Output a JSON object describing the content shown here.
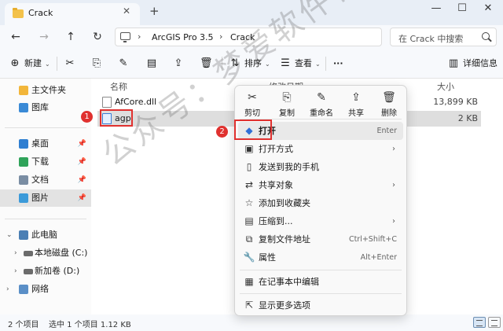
{
  "tab": {
    "title": "Crack",
    "close_glyph": "✕",
    "add_glyph": "+"
  },
  "window_controls": {
    "minimize": "—",
    "maximize": "☐",
    "close": "✕"
  },
  "nav_buttons": {
    "back": "←",
    "forward": "→",
    "up": "↑",
    "refresh": "↻"
  },
  "address": {
    "segments": [
      "ArcGIS Pro 3.5",
      "Crack"
    ],
    "separator": "›"
  },
  "search": {
    "placeholder": "在 Crack 中搜索"
  },
  "toolbar": {
    "new_label": "新建",
    "sort_label": "排序",
    "view_label": "查看",
    "more_glyph": "···",
    "details_label": "详细信息",
    "cut_icon": "scissors-icon",
    "copy_icon": "copy-icon",
    "rename_icon": "rename-icon",
    "share_icon": "share-icon",
    "delete_icon": "trash-icon"
  },
  "sidebar": {
    "items": [
      {
        "label": "主文件夹",
        "icon": "home-icon"
      },
      {
        "label": "图库",
        "icon": "gallery-icon"
      },
      {
        "label": "桌面",
        "icon": "desktop-icon",
        "pinned": true
      },
      {
        "label": "下载",
        "icon": "download-icon",
        "pinned": true
      },
      {
        "label": "文档",
        "icon": "document-icon",
        "pinned": true
      },
      {
        "label": "图片",
        "icon": "picture-icon",
        "pinned": true,
        "selected": true
      },
      {
        "label": "此电脑",
        "icon": "pc-icon"
      },
      {
        "label": "本地磁盘 (C:)",
        "icon": "drive-icon"
      },
      {
        "label": "新加卷 (D:)",
        "icon": "drive-icon"
      },
      {
        "label": "网络",
        "icon": "network-icon"
      }
    ]
  },
  "columns": {
    "name": "名称",
    "modified": "修改日期",
    "size": "大小"
  },
  "files": [
    {
      "name": "AfCore.dll",
      "size": "13,899 KB"
    },
    {
      "name": "agp",
      "size": "2 KB",
      "selected": true
    }
  ],
  "steps": {
    "one": "1",
    "two": "2"
  },
  "context_menu": {
    "quick_actions": [
      {
        "label": "剪切",
        "glyph": "✂"
      },
      {
        "label": "复制",
        "glyph": "⎘"
      },
      {
        "label": "重命名",
        "glyph": "✎"
      },
      {
        "label": "共享",
        "glyph": "⇪"
      },
      {
        "label": "删除",
        "glyph": "🗑"
      }
    ],
    "items": [
      {
        "label": "打开",
        "shortcut": "Enter",
        "glyph": "◆",
        "bold": true,
        "hover": true
      },
      {
        "label": "打开方式",
        "glyph": "▣",
        "submenu": true
      },
      {
        "label": "发送到我的手机",
        "glyph": "▯"
      },
      {
        "label": "共享对象",
        "glyph": "⇄",
        "submenu": true
      },
      {
        "label": "添加到收藏夹",
        "glyph": "☆"
      },
      {
        "label": "压缩到...",
        "glyph": "▤",
        "submenu": true
      },
      {
        "label": "复制文件地址",
        "shortcut": "Ctrl+Shift+C",
        "glyph": "⧉"
      },
      {
        "label": "属性",
        "shortcut": "Alt+Enter",
        "glyph": "🔧"
      },
      {
        "label": "在记事本中编辑",
        "glyph": "▦"
      },
      {
        "label": "显示更多选项",
        "glyph": "⇱"
      }
    ]
  },
  "status": {
    "count": "2 个项目",
    "selection": "选中 1 个项目  1.12 KB"
  },
  "watermark": "公众号：梦爱软件管家",
  "colors": {
    "highlight": "#e0312f",
    "folder": "#f3c24a"
  }
}
